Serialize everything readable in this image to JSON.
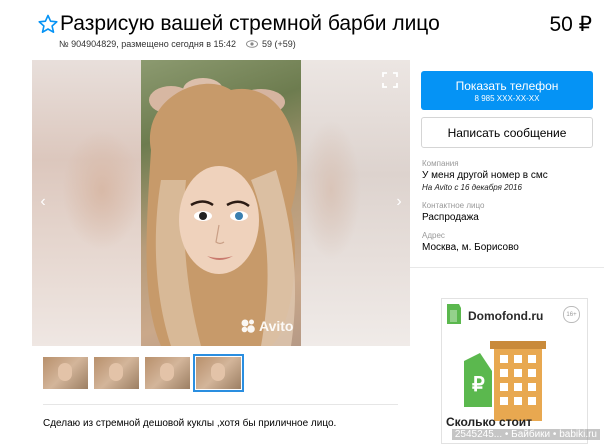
{
  "header": {
    "title": "Разрисую вашей стремной барби лицо",
    "price": "50 ₽",
    "meta": "№ 904904829, размещено сегодня в 15:42",
    "views": "59 (+59)"
  },
  "gallery": {
    "watermark": "Avito",
    "thumbnails": [
      {
        "active": false
      },
      {
        "active": false
      },
      {
        "active": false
      },
      {
        "active": true
      }
    ]
  },
  "description": "Сделаю из стремной дешовой куклы ,хотя бы приличное лицо.",
  "sidebar": {
    "phone_button": "Показать телефон",
    "phone_number": "8 985 XXX-XX-XX",
    "message_button": "Написать сообщение",
    "company_label": "Компания",
    "company_value": "У меня другой номер в смс",
    "company_since": "На Avito с 16 декабря 2016",
    "contact_label": "Контактное лицо",
    "contact_value": "Распродажа",
    "address_label": "Адрес",
    "address_value": "Москва, м. Борисово"
  },
  "ad": {
    "brand": "Domofond.ru",
    "age": "16+",
    "tagline": "Сколько стоит"
  },
  "site_watermark": "2545245...  • Байбики • babiki.ru",
  "colors": {
    "accent": "#0593f5",
    "brand_green": "#5bb84e"
  }
}
